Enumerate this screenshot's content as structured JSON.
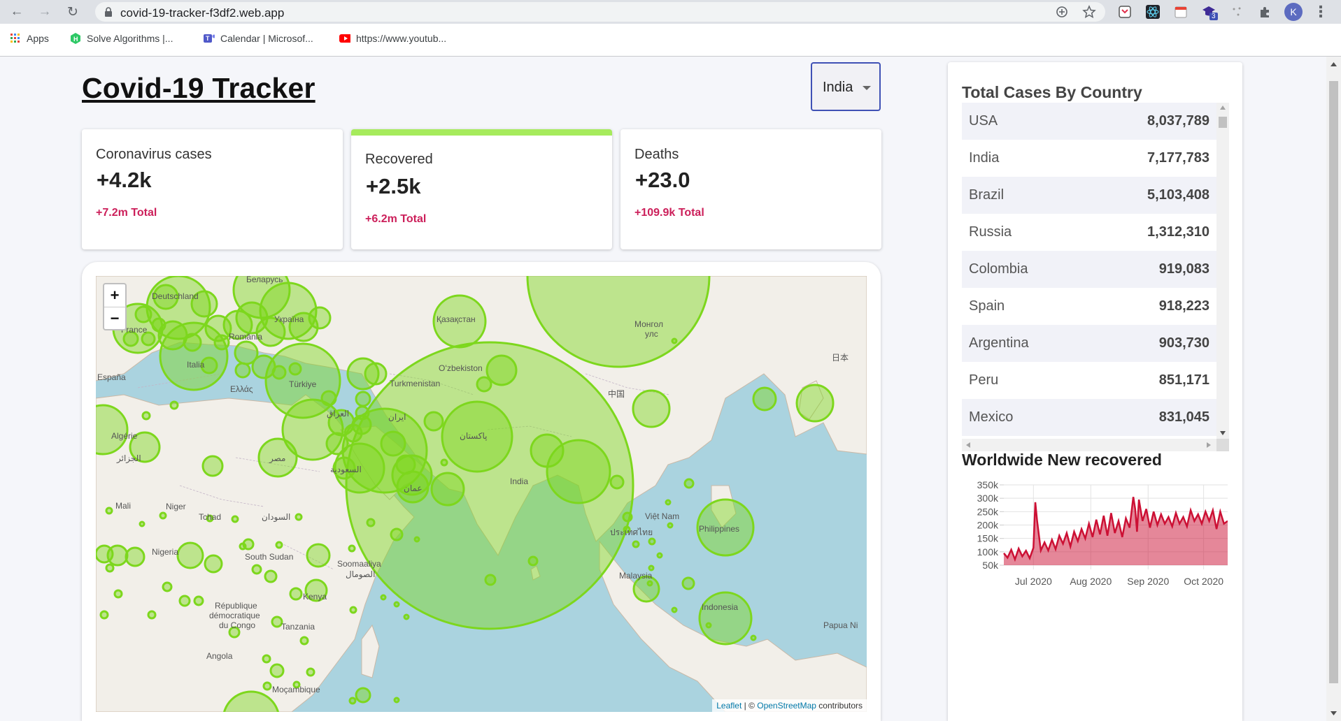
{
  "browser": {
    "url": "covid-19-tracker-f3df2.web.app",
    "profile_initial": "K",
    "extension_badge": "3",
    "bookmarks": [
      {
        "label": "Apps",
        "icon": "apps-grid-icon"
      },
      {
        "label": "Solve Algorithms |...",
        "icon": "hackerrank-icon"
      },
      {
        "label": "Calendar | Microsof...",
        "icon": "teams-icon"
      },
      {
        "label": "https://www.youtub...",
        "icon": "youtube-icon"
      }
    ]
  },
  "app": {
    "title": "Covid-19 Tracker",
    "country_select": {
      "value": "India"
    }
  },
  "info_cards": [
    {
      "title": "Coronavirus cases",
      "value": "+4.2k",
      "total": "+7.2m Total",
      "selected": false
    },
    {
      "title": "Recovered",
      "value": "+2.5k",
      "total": "+6.2m Total",
      "selected": true
    },
    {
      "title": "Deaths",
      "value": "+23.0",
      "total": "+109.9k Total",
      "selected": false
    }
  ],
  "map": {
    "zoom_in": "+",
    "zoom_out": "−",
    "attribution": {
      "leaflet": "Leaflet",
      "sep": " | © ",
      "osm": "OpenStreetMap",
      "suffix": " contributors"
    },
    "labels": [
      "Беларусь",
      "Deutschland",
      "Україна",
      "France",
      "România",
      "Italia",
      "España",
      "Türkiye",
      "Ελλάς",
      "Қазақстан",
      "Монгол",
      "улс",
      "日本",
      "Oʻzbekiston",
      "Turkmenistan",
      "中国",
      "العراق",
      "ایران",
      "پاکستان",
      "Algérie",
      "الجزائر",
      "مصر",
      "السعودية",
      "India",
      "Mali",
      "Niger",
      "Tchad",
      "السودان",
      "Nigeria",
      "South Sudan",
      "Soomaaliya",
      "الصومال",
      "Việt Nam",
      "ประเทศไทย",
      "Philippines",
      "Malaysia",
      "République",
      "démocratique",
      "du Congo",
      "Kenya",
      "Tanzania",
      "Indonesia",
      "Papua Ni",
      "Angola",
      "Moçambique",
      "عمان"
    ],
    "marker_color": "#7dd71d"
  },
  "right_panel": {
    "table_title": "Total Cases By Country",
    "countries": [
      {
        "country": "USA",
        "cases": "8,037,789"
      },
      {
        "country": "India",
        "cases": "7,177,783"
      },
      {
        "country": "Brazil",
        "cases": "5,103,408"
      },
      {
        "country": "Russia",
        "cases": "1,312,310"
      },
      {
        "country": "Colombia",
        "cases": "919,083"
      },
      {
        "country": "Spain",
        "cases": "918,223"
      },
      {
        "country": "Argentina",
        "cases": "903,730"
      },
      {
        "country": "Peru",
        "cases": "851,171"
      },
      {
        "country": "Mexico",
        "cases": "831,045"
      }
    ],
    "chart_title": "Worldwide New recovered"
  },
  "chart_data": {
    "type": "area",
    "title": "Worldwide New recovered",
    "xlabel": "",
    "ylabel": "",
    "x_ticks": [
      "Jul 2020",
      "Aug 2020",
      "Sep 2020",
      "Oct 2020"
    ],
    "y_ticks": [
      "50k",
      "100k",
      "150k",
      "200k",
      "250k",
      "300k",
      "350k"
    ],
    "ylim": [
      50000,
      350000
    ],
    "xlim": [
      "2020-06-15",
      "2020-10-14"
    ],
    "grid": true,
    "series": [
      {
        "color": "#cc1034",
        "fill": "rgba(204,16,52,0.5)",
        "points": [
          [
            "2020-06-15",
            95000
          ],
          [
            "2020-06-17",
            78000
          ],
          [
            "2020-06-19",
            108000
          ],
          [
            "2020-06-21",
            72000
          ],
          [
            "2020-06-23",
            112000
          ],
          [
            "2020-06-25",
            83000
          ],
          [
            "2020-06-27",
            104000
          ],
          [
            "2020-06-29",
            76000
          ],
          [
            "2020-07-01",
            115000
          ],
          [
            "2020-07-02",
            285000
          ],
          [
            "2020-07-03",
            215000
          ],
          [
            "2020-07-05",
            105000
          ],
          [
            "2020-07-07",
            135000
          ],
          [
            "2020-07-09",
            105000
          ],
          [
            "2020-07-11",
            145000
          ],
          [
            "2020-07-13",
            110000
          ],
          [
            "2020-07-15",
            160000
          ],
          [
            "2020-07-17",
            130000
          ],
          [
            "2020-07-19",
            170000
          ],
          [
            "2020-07-21",
            120000
          ],
          [
            "2020-07-23",
            175000
          ],
          [
            "2020-07-25",
            140000
          ],
          [
            "2020-07-27",
            185000
          ],
          [
            "2020-07-29",
            150000
          ],
          [
            "2020-07-31",
            205000
          ],
          [
            "2020-08-02",
            155000
          ],
          [
            "2020-08-04",
            220000
          ],
          [
            "2020-08-06",
            165000
          ],
          [
            "2020-08-08",
            235000
          ],
          [
            "2020-08-10",
            160000
          ],
          [
            "2020-08-12",
            245000
          ],
          [
            "2020-08-14",
            170000
          ],
          [
            "2020-08-16",
            215000
          ],
          [
            "2020-08-18",
            155000
          ],
          [
            "2020-08-20",
            225000
          ],
          [
            "2020-08-22",
            190000
          ],
          [
            "2020-08-24",
            305000
          ],
          [
            "2020-08-25",
            260000
          ],
          [
            "2020-08-26",
            175000
          ],
          [
            "2020-08-27",
            295000
          ],
          [
            "2020-08-29",
            215000
          ],
          [
            "2020-08-31",
            260000
          ],
          [
            "2020-09-02",
            190000
          ],
          [
            "2020-09-04",
            250000
          ],
          [
            "2020-09-06",
            200000
          ],
          [
            "2020-09-08",
            240000
          ],
          [
            "2020-09-10",
            205000
          ],
          [
            "2020-09-12",
            230000
          ],
          [
            "2020-09-14",
            195000
          ],
          [
            "2020-09-16",
            245000
          ],
          [
            "2020-09-18",
            205000
          ],
          [
            "2020-09-20",
            230000
          ],
          [
            "2020-09-22",
            195000
          ],
          [
            "2020-09-24",
            255000
          ],
          [
            "2020-09-26",
            215000
          ],
          [
            "2020-09-28",
            240000
          ],
          [
            "2020-09-30",
            205000
          ],
          [
            "2020-10-02",
            250000
          ],
          [
            "2020-10-04",
            215000
          ],
          [
            "2020-10-06",
            255000
          ],
          [
            "2020-10-08",
            185000
          ],
          [
            "2020-10-10",
            250000
          ],
          [
            "2020-10-12",
            205000
          ],
          [
            "2020-10-14",
            215000
          ]
        ]
      }
    ]
  }
}
